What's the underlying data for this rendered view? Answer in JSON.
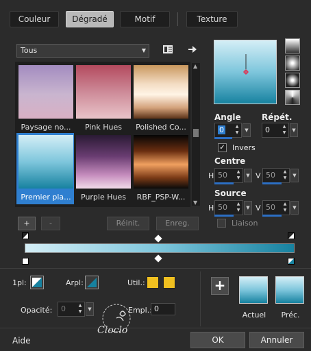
{
  "tabs": [
    {
      "label": "Couleur",
      "active": false
    },
    {
      "label": "Dégradé",
      "active": true
    },
    {
      "label": "Motif",
      "active": false
    },
    {
      "label": "Texture",
      "active": false
    }
  ],
  "category_dropdown": {
    "value": "Tous"
  },
  "gradients": [
    {
      "label": "Paysage no...",
      "selected": false
    },
    {
      "label": "Pink Hues",
      "selected": false
    },
    {
      "label": "Polished Co...",
      "selected": false
    },
    {
      "label": "Premier pla...",
      "selected": true
    },
    {
      "label": "Purple Hues",
      "selected": false
    },
    {
      "label": "RBF_PSP-W...",
      "selected": false
    }
  ],
  "list_buttons": {
    "add": "+",
    "remove": "-",
    "reset": "Réinit.",
    "save": "Enreg."
  },
  "angle": {
    "label": "Angle",
    "value": "0"
  },
  "repeat": {
    "label": "Répét.",
    "value": "0"
  },
  "invert": {
    "label": "Invers",
    "checked": true
  },
  "center": {
    "label": "Centre",
    "h_label": "H",
    "h": "50",
    "v_label": "V",
    "v": "50"
  },
  "source": {
    "label": "Source",
    "h_label": "H",
    "h": "50",
    "v_label": "V",
    "v": "50"
  },
  "link": {
    "label": "Liaison",
    "checked": false
  },
  "stops": {
    "first_label": "1pl:",
    "back_label": "Arpl:",
    "user_label": "Util.:",
    "opacity_label": "Opacité:",
    "opacity": "0",
    "location_label": "Empl.:",
    "location": "0",
    "user_color": "#f0c020"
  },
  "preview": {
    "current_label": "Actuel",
    "previous_label": "Préc."
  },
  "footer": {
    "help": "Aide",
    "ok": "OK",
    "cancel": "Annuler"
  },
  "watermark": "Cloclo",
  "colors": {
    "gradient_top": "#d4eef6",
    "gradient_bottom": "#1782a0",
    "selection": "#2f7fd0",
    "accent": "#2c6fc4"
  }
}
